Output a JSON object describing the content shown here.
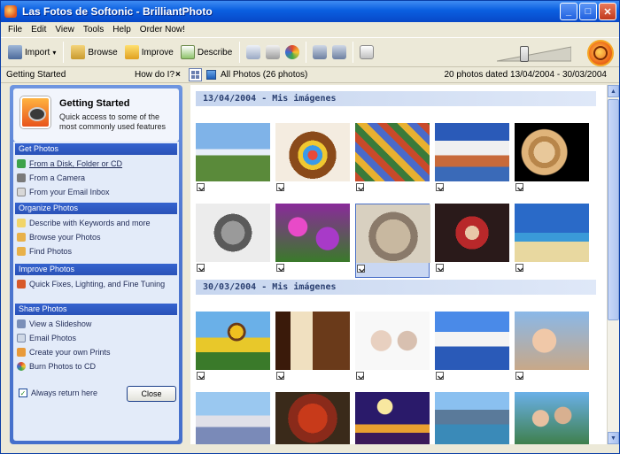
{
  "window": {
    "title": "Las Fotos de Softonic - BrilliantPhoto"
  },
  "menu": [
    "File",
    "Edit",
    "View",
    "Tools",
    "Help",
    "Order Now!"
  ],
  "toolbar": {
    "import_label": "Import",
    "browse_label": "Browse",
    "improve_label": "Improve",
    "describe_label": "Describe",
    "icons": [
      "mail-icon",
      "print-icon",
      "burn-cd-icon",
      "share-icon",
      "upload-icon",
      "card-icon"
    ],
    "zoom_level": 0.35
  },
  "statusbar": {
    "left": "Getting Started",
    "how": "How do I?",
    "close": "×",
    "all_photos": "All Photos (26 photos)",
    "date_range": "20 photos dated 13/04/2004 - 30/03/2004"
  },
  "left_panel": {
    "title": "Getting Started",
    "desc": "Quick access to some of the most commonly used features",
    "sections": [
      {
        "label": "Get Photos",
        "items": [
          "From a Disk, Folder or CD",
          "From a Camera",
          "From your Email Inbox"
        ]
      },
      {
        "label": "Organize Photos",
        "items": [
          "Describe with Keywords and more",
          "Browse your Photos",
          "Find Photos"
        ]
      },
      {
        "label": "Improve Photos",
        "items": [
          "Quick Fixes, Lighting, and Fine Tuning"
        ]
      },
      {
        "label": "Share Photos",
        "items": [
          "View a Slideshow",
          "Email Photos",
          "Create your own Prints",
          "Burn Photos to CD"
        ]
      }
    ],
    "always_return": "Always return here",
    "close_label": "Close"
  },
  "gallery": {
    "groups": [
      {
        "date_label": "13/04/2004 - Mis imágenes",
        "photos": [
          "house-field",
          "easter-eggs-basket",
          "colorful-eggs",
          "volcano-clouds",
          "jupiter",
          "wolf",
          "pink-flowers",
          "cat",
          "child-red",
          "palm-beach"
        ]
      },
      {
        "date_label": "30/03/2004 - Mis imágenes",
        "photos": [
          "sunflowers",
          "window-room",
          "babies",
          "coastal-village",
          "girl-sunglasses",
          "pavilion",
          "autumn-tree",
          "night-moon",
          "lake-mountains",
          "family-portrait"
        ]
      }
    ]
  },
  "colors": {
    "titlebar": "#0a5fe0",
    "panel": "#4f77cf",
    "section_head": "#2a52b8",
    "date_header": "#c7d6ef",
    "selection": "#c9d7f2"
  }
}
